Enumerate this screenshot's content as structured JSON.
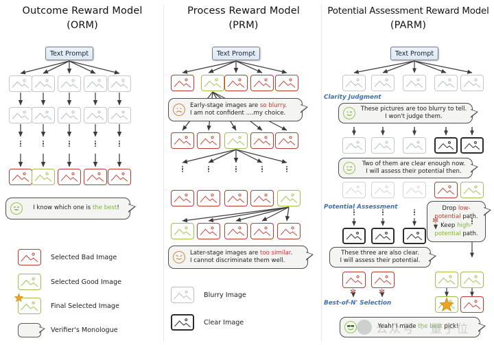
{
  "figure": {
    "columns": [
      {
        "id": "orm",
        "title_line1": "Outcome Reward Model",
        "title_line2": "(ORM)",
        "prompt": "Text Prompt",
        "bubble": {
          "prefix": "I know which one is ",
          "highlight": "the best",
          "suffix": "!",
          "face": "grinning-face"
        }
      },
      {
        "id": "prm",
        "title_line1": "Process Reward Model",
        "title_line2": "(PRM)",
        "prompt": "Text Prompt",
        "bubble_top": {
          "line1_prefix": "Early-stage images  are ",
          "line1_highlight": "so blurry",
          "line1_suffix": ".",
          "line2": "I am not confident ....my choice.",
          "face": "sad-face"
        },
        "bubble_bottom": {
          "line1_prefix": "Later-stage images are ",
          "line1_highlight": "too similar",
          "line1_suffix": ".",
          "line2": "I cannot discriminate them well.",
          "face": "confounded-face"
        }
      },
      {
        "id": "parm",
        "title_line1": "Potential Assessment Reward Model",
        "title_line2": "(PARM)",
        "prompt": "Text Prompt",
        "stage_labels": {
          "clarity": "Clarity Judgment",
          "potential": "Potential Assessment",
          "best_of_n": "Best-of-N' Selection"
        },
        "bubble_clarity": {
          "line1": "These pictures are too blurry to tell.",
          "line2": "I won't judge them.",
          "face": "winking-face"
        },
        "bubble_clear_two": {
          "line1": "Two of them are clear enough now.",
          "line2": "I will assess their potential then.",
          "face": "winking-face"
        },
        "bubble_drop": {
          "l1_a": "Drop ",
          "l1_b": "low-",
          "l2_a": "potential",
          "l2_b": " path.",
          "l3_a": "Keep ",
          "l3_b": "high-",
          "l4_a": "potential",
          "l4_b": " path."
        },
        "bubble_three_clear": {
          "line1": "These three are also clear.",
          "line2": "I will assess their potential."
        },
        "bubble_final": {
          "prefix": "Yeah! I made ",
          "highlight": "the best",
          "suffix": " pick!",
          "face": "sunglasses-face"
        }
      }
    ],
    "legend_left": [
      {
        "label": "Selected Bad Image",
        "swatch": "bad-image-card"
      },
      {
        "label": "Selected Good Image",
        "swatch": "good-image-card"
      },
      {
        "label": "Final Selected Image",
        "swatch": "final-image-card"
      },
      {
        "label": "Verifier's Monologue",
        "swatch": "speech-bubble"
      }
    ],
    "legend_middle": [
      {
        "label": "Blurry Image",
        "swatch": "blurry-image-card"
      },
      {
        "label": "Clear Image",
        "swatch": "clear-image-card"
      }
    ],
    "watermark": "公众号 · 量子位",
    "colors": {
      "bad_red": "#c0392f",
      "good_green": "#9cc14a",
      "blurry_gray": "#b9bec4",
      "clear_black": "#2c2c2c",
      "stage_label_blue": "#3f6fb5",
      "prompt_blue": "#dde7f1"
    }
  }
}
